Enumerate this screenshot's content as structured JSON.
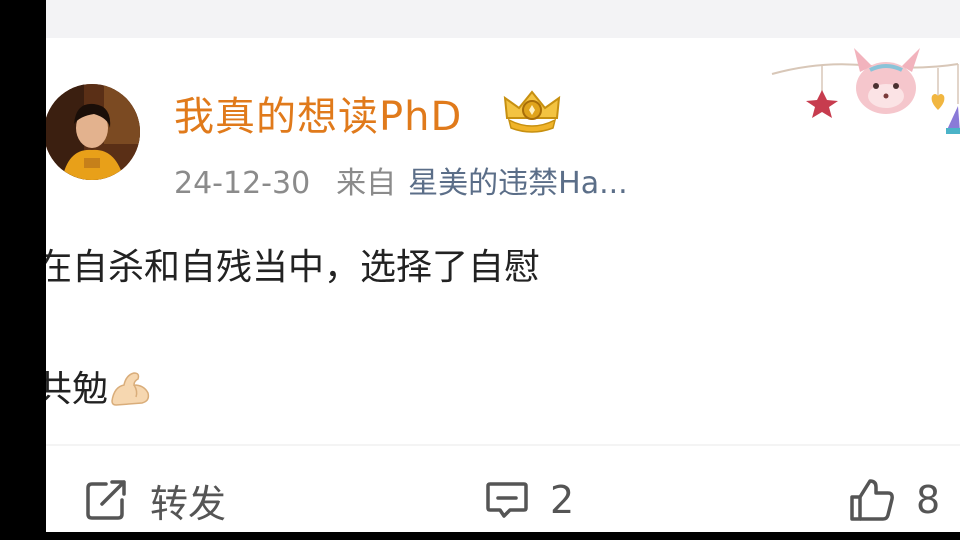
{
  "post": {
    "username": "我真的想读PhD",
    "date": "24-12-30",
    "source_prefix": "来自",
    "source": "星美的违禁Ha...",
    "line1": "在自杀和自残当中，选择了自慰",
    "line2": "共勉"
  },
  "actions": {
    "repost_label": "转发",
    "comment_count": "2",
    "like_count": "8"
  },
  "icons": {
    "vip": "vip-crown-icon",
    "repost": "repost-icon",
    "comment": "comment-icon",
    "like": "thumbs-up-icon",
    "emoji": "flexed-biceps-emoji"
  },
  "colors": {
    "username": "#e07a1b",
    "meta": "#8b8b8b",
    "source": "#5b6e88",
    "text": "#222222"
  }
}
